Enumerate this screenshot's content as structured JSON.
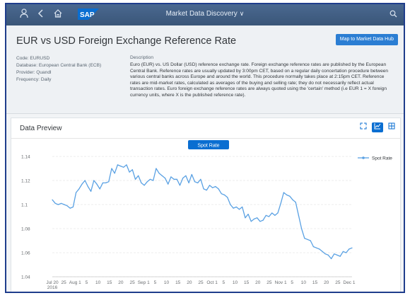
{
  "shell": {
    "title": "Market Data Discovery",
    "chevron": "∨",
    "icons": [
      "user-icon",
      "back-icon",
      "home-icon",
      "search-icon"
    ],
    "logo_text": "SAP",
    "logo_color": "#0a6ed1"
  },
  "page": {
    "title": "EUR vs USD Foreign Exchange Reference Rate",
    "hub_button_label": "Map to Market Data Hub",
    "accent": "#2b7ed3"
  },
  "meta": {
    "code": "Code: EURUSD",
    "database": "Database: European Central Bank (ECB)",
    "provider": "Provider: Quandl",
    "frequency": "Frequency: Daily",
    "description_label": "Description",
    "description": "Euro (EUR) vs. US Dollar (USD) reference exchange rate. Foreign exchange reference rates are published by the European Central Bank. Reference rates are usually updated by 3:00pm CET, based on a regular daily concertation procedure between various central banks across Europe and around the world. This procedure normally takes place at 2:15pm CET. Reference rates are mid-market rates, calculated as averages of the buying and selling rate; they do not necessarily reflect actual transaction rates. Euro foreign exchange reference rates are always quoted using the 'certain' method (i.e EUR 1 = X foreign currency units, where X is the published reference rate)."
  },
  "preview": {
    "title": "Data Preview",
    "toolbar": [
      "fullscreen-icon",
      "line-chart-icon",
      "table-icon"
    ]
  },
  "chart_data": {
    "type": "line",
    "title": "Spot Rate",
    "ylim": [
      1.04,
      1.14
    ],
    "yticks": [
      "1.14",
      "1.12",
      "1.1",
      "1.08",
      "1.06",
      "1.04"
    ],
    "xtick_labels": [
      "Jul 20",
      "25",
      "Aug 1",
      "5",
      "10",
      "15",
      "20",
      "25",
      "Sep 1",
      "5",
      "10",
      "15",
      "20",
      "25",
      "Oct 1",
      "5",
      "10",
      "15",
      "20",
      "25",
      "Nov 1",
      "5",
      "10",
      "15",
      "20",
      "25",
      "Dec 1"
    ],
    "year_label": "2016",
    "legend_position": "top-right",
    "series": [
      {
        "name": "Spot Rate",
        "color": "#5aa1e3",
        "values": [
          1.104,
          1.101,
          1.1,
          1.101,
          1.1,
          1.099,
          1.097,
          1.098,
          1.11,
          1.113,
          1.117,
          1.12,
          1.115,
          1.111,
          1.12,
          1.117,
          1.113,
          1.118,
          1.118,
          1.119,
          1.13,
          1.126,
          1.133,
          1.132,
          1.131,
          1.133,
          1.127,
          1.129,
          1.121,
          1.124,
          1.118,
          1.116,
          1.119,
          1.121,
          1.12,
          1.13,
          1.126,
          1.124,
          1.122,
          1.117,
          1.123,
          1.121,
          1.121,
          1.116,
          1.122,
          1.124,
          1.118,
          1.125,
          1.119,
          1.118,
          1.121,
          1.113,
          1.112,
          1.116,
          1.114,
          1.115,
          1.113,
          1.109,
          1.108,
          1.106,
          1.1,
          1.097,
          1.098,
          1.096,
          1.098,
          1.089,
          1.092,
          1.086,
          1.088,
          1.089,
          1.086,
          1.087,
          1.091,
          1.09,
          1.093,
          1.091,
          1.093,
          1.101,
          1.11,
          1.108,
          1.107,
          1.104,
          1.102,
          1.091,
          1.08,
          1.072,
          1.071,
          1.07,
          1.065,
          1.064,
          1.063,
          1.061,
          1.059,
          1.058,
          1.055,
          1.059,
          1.058,
          1.057,
          1.061,
          1.06,
          1.063,
          1.064
        ]
      }
    ]
  }
}
